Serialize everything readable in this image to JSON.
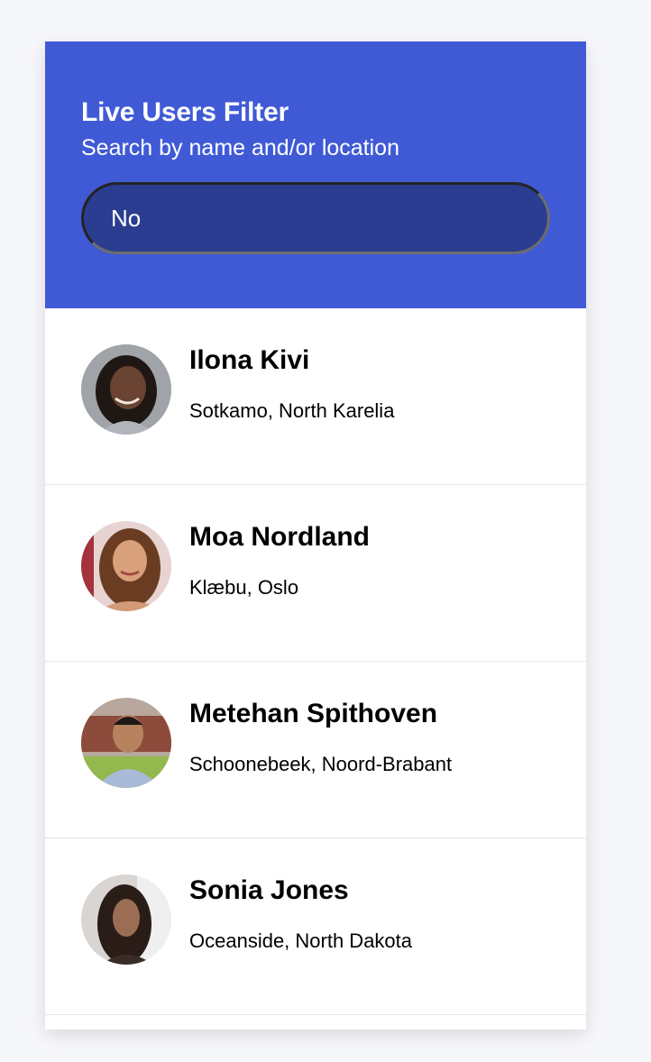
{
  "header": {
    "title": "Live Users Filter",
    "subtitle": "Search by name and/or location"
  },
  "search": {
    "value": "No",
    "placeholder": ""
  },
  "colors": {
    "header_bg": "#405ad6",
    "input_bg": "#2b3d91",
    "page_bg": "#f6f7fb"
  },
  "users": [
    {
      "name": "Ilona Kivi",
      "location": "Sotkamo, North Karelia",
      "avatar": "user-photo"
    },
    {
      "name": "Moa Nordland",
      "location": "Klæbu, Oslo",
      "avatar": "user-photo"
    },
    {
      "name": "Metehan Spithoven",
      "location": "Schoonebeek, Noord-Brabant",
      "avatar": "user-photo"
    },
    {
      "name": "Sonia Jones",
      "location": "Oceanside, North Dakota",
      "avatar": "user-photo"
    }
  ]
}
